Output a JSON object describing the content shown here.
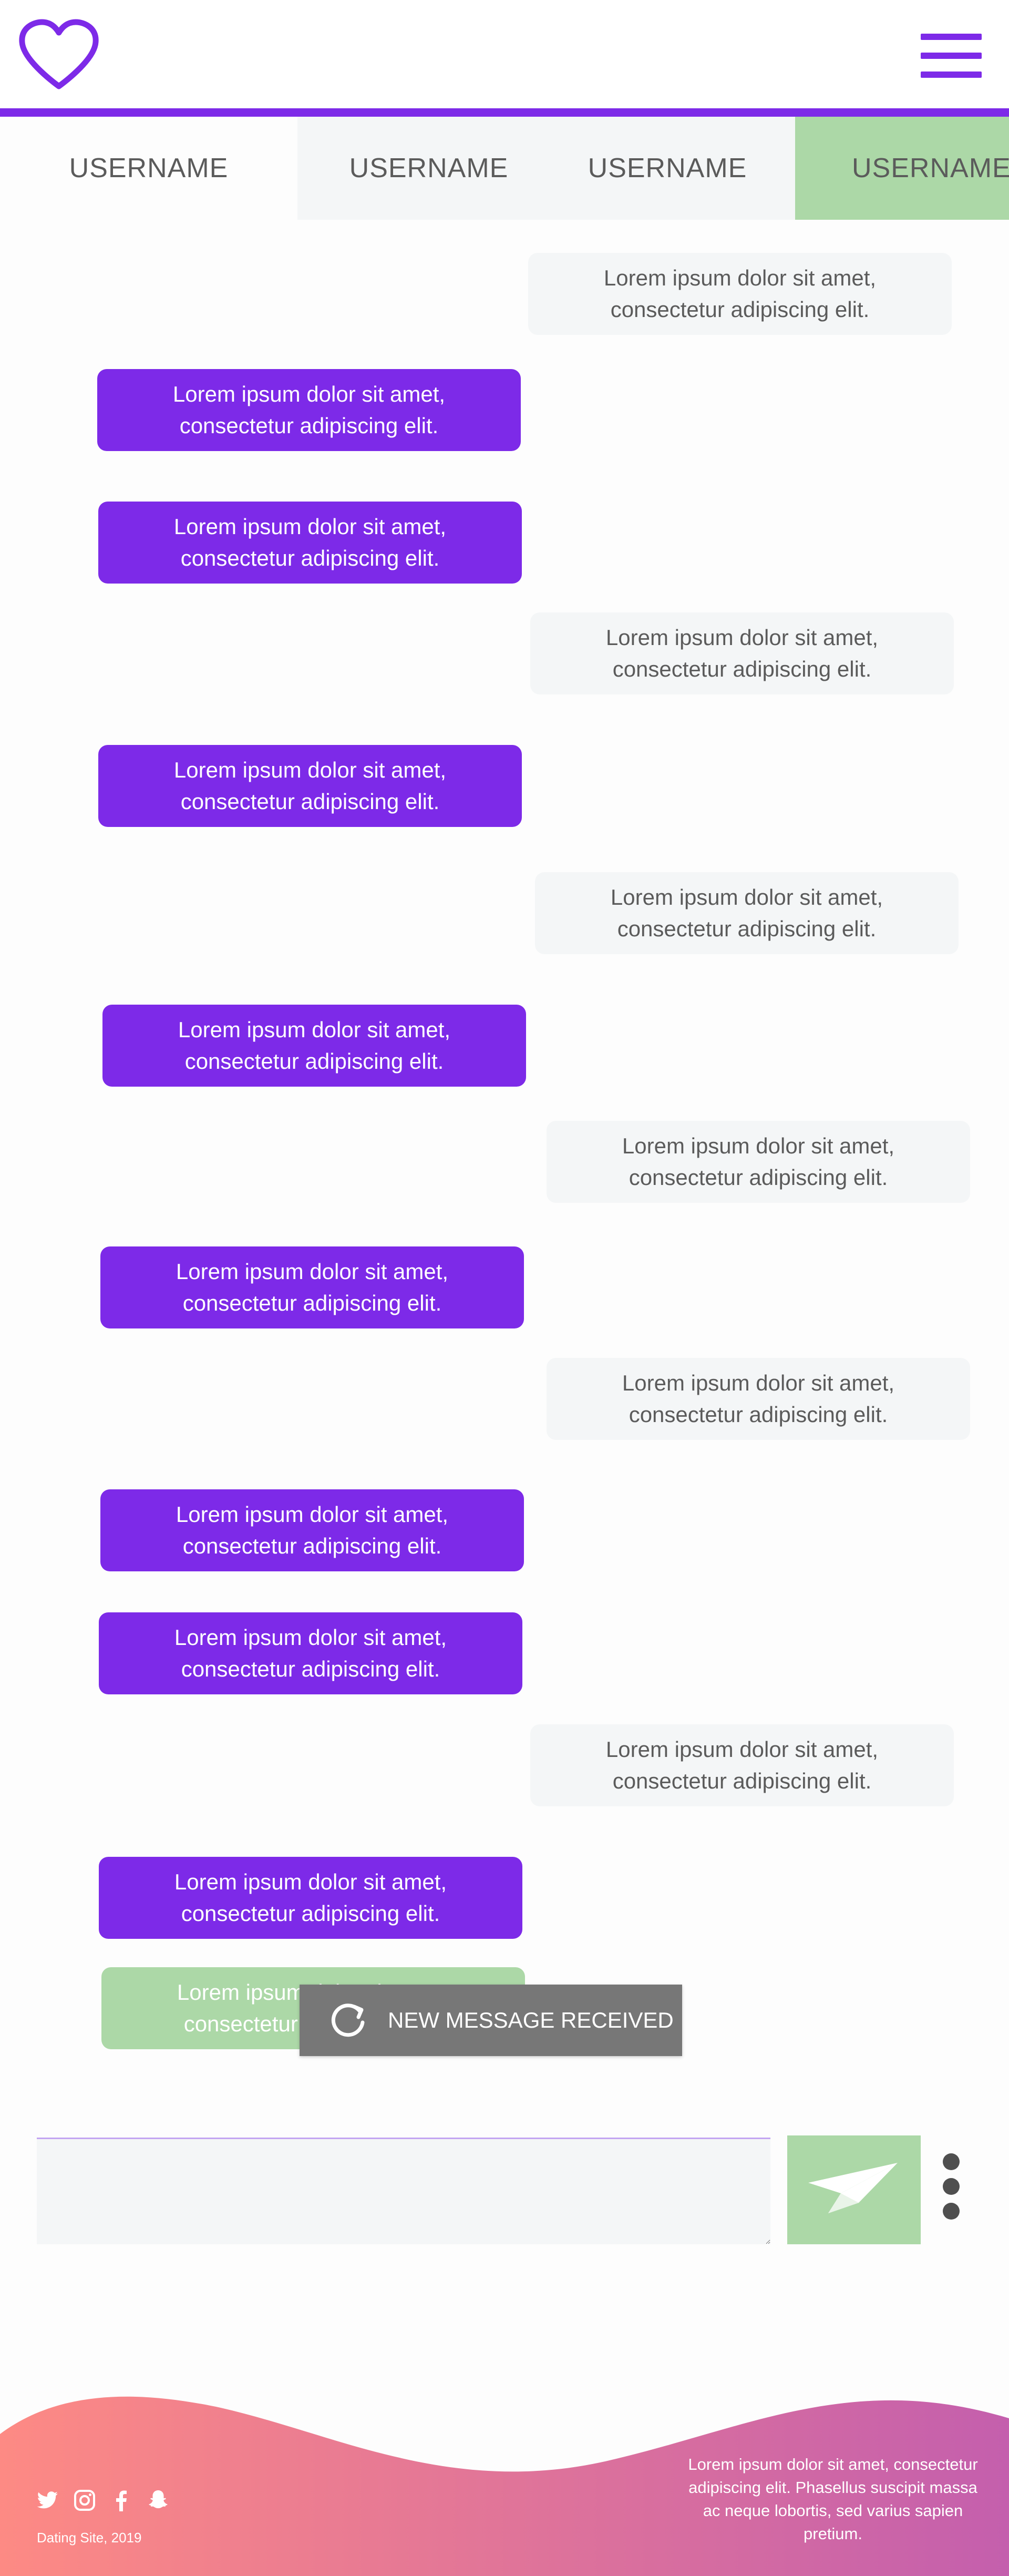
{
  "header": {
    "logo_icon": "heart-outline-icon",
    "menu_icon": "hamburger-menu-icon",
    "accent_color": "#7d2ae8"
  },
  "tabs": [
    {
      "label": "USERNAME",
      "state": "active"
    },
    {
      "label": "USERNAME",
      "state": "inactive"
    },
    {
      "label": "USERNAME",
      "state": "inactive"
    },
    {
      "label": "USERNAME",
      "state": "highlighted"
    }
  ],
  "messages": [
    {
      "direction": "incoming",
      "text": "Lorem ipsum dolor sit amet, consectetur adipiscing elit."
    },
    {
      "direction": "outgoing",
      "text": "Lorem ipsum dolor sit amet, consectetur adipiscing elit."
    },
    {
      "direction": "outgoing",
      "text": "Lorem ipsum dolor sit amet, consectetur adipiscing elit."
    },
    {
      "direction": "incoming",
      "text": "Lorem ipsum dolor sit amet, consectetur adipiscing elit."
    },
    {
      "direction": "outgoing",
      "text": "Lorem ipsum dolor sit amet, consectetur adipiscing elit."
    },
    {
      "direction": "incoming",
      "text": "Lorem ipsum dolor sit amet, consectetur adipiscing elit."
    },
    {
      "direction": "outgoing",
      "text": "Lorem ipsum dolor sit amet, consectetur adipiscing elit."
    },
    {
      "direction": "incoming",
      "text": "Lorem ipsum dolor sit amet, consectetur adipiscing elit."
    },
    {
      "direction": "outgoing",
      "text": "Lorem ipsum dolor sit amet, consectetur adipiscing elit."
    },
    {
      "direction": "incoming",
      "text": "Lorem ipsum dolor sit amet, consectetur adipiscing elit."
    },
    {
      "direction": "outgoing",
      "text": "Lorem ipsum dolor sit amet, consectetur adipiscing elit."
    },
    {
      "direction": "outgoing",
      "text": "Lorem ipsum dolor sit amet, consectetur adipiscing elit."
    },
    {
      "direction": "incoming",
      "text": "Lorem ipsum dolor sit amet, consectetur adipiscing elit."
    },
    {
      "direction": "outgoing",
      "text": "Lorem ipsum dolor sit amet, consectetur adipiscing elit."
    },
    {
      "direction": "pending",
      "text": "Lorem ipsum dolor sit amet, consectetur adipiscing elit."
    }
  ],
  "toast": {
    "icon": "refresh-icon",
    "text": "NEW MESSAGE RECEIVED"
  },
  "composer": {
    "value": "",
    "placeholder": "",
    "send_icon": "paper-plane-icon",
    "more_icon": "vertical-dots-icon"
  },
  "footer": {
    "social_icons": [
      "twitter-icon",
      "instagram-icon",
      "facebook-icon",
      "snapchat-icon"
    ],
    "copyright": "Dating Site, 2019",
    "description": "Lorem ipsum dolor sit amet, consectetur adipiscing elit. Phasellus suscipit massa ac neque lobortis, sed varius sapien pretium.",
    "gradient_start": "#fd8a84",
    "gradient_end": "#c45fad"
  },
  "colors": {
    "outgoing_bubble": "#7d2ae8",
    "incoming_bubble": "#f4f6f7",
    "pending_bubble": "#acd8a7",
    "toast_bg": "#777777"
  }
}
